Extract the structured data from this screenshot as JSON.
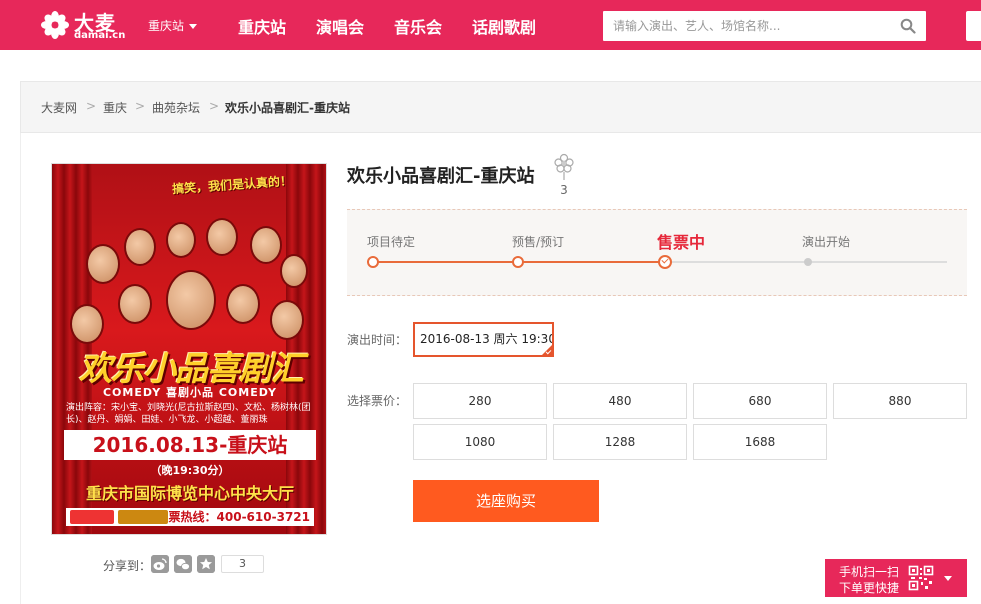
{
  "header": {
    "brand_cn": "大麦",
    "brand_en": "damai.cn",
    "city": "重庆站",
    "nav": [
      "重庆站",
      "演唱会",
      "音乐会",
      "话剧歌剧"
    ],
    "search_placeholder": "请输入演出、艺人、场馆名称...",
    "brand_color": "#e7285a"
  },
  "breadcrumb": {
    "items": [
      "大麦网",
      "重庆",
      "曲苑杂坛"
    ],
    "current": "欢乐小品喜剧汇-重庆站",
    "separator": ">"
  },
  "poster": {
    "tagline": "搞笑，我们是认真的！",
    "headline": "欢乐小品喜剧汇",
    "subtitle": "COMEDY 喜剧小品 COMEDY",
    "cast": "演出阵容：宋小宝、刘晓光(尼古拉斯赵四)、文松、杨树林(团长)、赵丹、娟娟、田娃、小飞龙、小超越、董丽珠",
    "date": "2016.08.13-重庆站",
    "time": "（晚19:30分）",
    "venue": "重庆市国际博览中心中央大厅",
    "hotline": "售票热线：400-610-3721"
  },
  "share": {
    "label": "分享到：",
    "count": "3",
    "icons": [
      "weibo-icon",
      "wechat-icon",
      "favorite-icon"
    ]
  },
  "event": {
    "title": "欢乐小品喜剧汇-重庆站",
    "like_count": "3"
  },
  "progress": {
    "steps": [
      "项目待定",
      "预售/预订",
      "售票中",
      "演出开始"
    ],
    "current_index": 2
  },
  "show_time": {
    "label": "演出时间：",
    "selected": "2016-08-13 周六 19:30"
  },
  "prices": {
    "label": "选择票价：",
    "options": [
      "280",
      "480",
      "680",
      "880",
      "1080",
      "1288",
      "1688"
    ]
  },
  "buy_button": "选座购买",
  "mobile_badge": {
    "line1": "手机扫一扫",
    "line2": "下单更快捷"
  },
  "colors": {
    "accent": "#e7285a",
    "buy": "#ff5a1f",
    "progress": "#e96b3a",
    "active_step": "#e6283a"
  }
}
